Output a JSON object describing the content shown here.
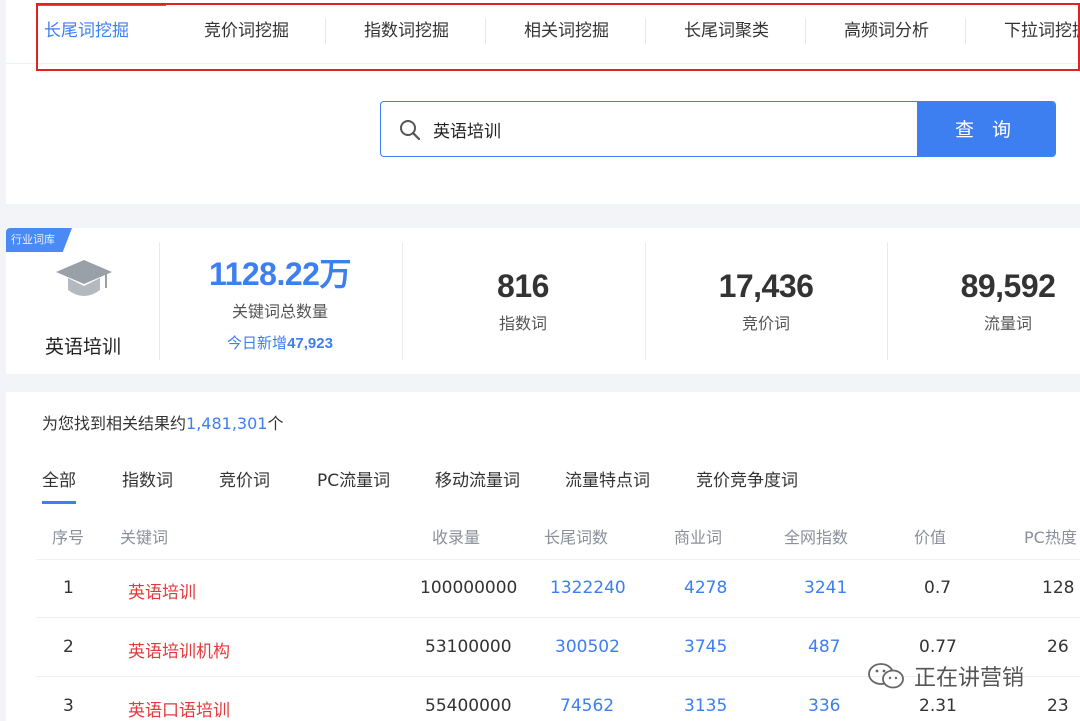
{
  "tabs": [
    {
      "label": "长尾词挖掘",
      "active": true
    },
    {
      "label": "竞价词挖掘"
    },
    {
      "label": "指数词挖掘"
    },
    {
      "label": "相关词挖掘"
    },
    {
      "label": "长尾词聚类"
    },
    {
      "label": "高频词分析"
    },
    {
      "label": "下拉词挖掘"
    }
  ],
  "search": {
    "value": "英语培训",
    "button_label": "查 询"
  },
  "industry": {
    "badge": "行业词库",
    "name": "英语培训"
  },
  "stats": {
    "total": {
      "value": "1128.22万",
      "label": "关键词总数量",
      "today_prefix": "今日新增",
      "today_value": "47,923"
    },
    "index_words": {
      "value": "816",
      "label": "指数词"
    },
    "bid_words": {
      "value": "17,436",
      "label": "竞价词"
    },
    "traffic_words": {
      "value": "89,592",
      "label": "流量词"
    }
  },
  "results": {
    "prefix": "为您找到相关结果约",
    "count": "1,481,301",
    "suffix": "个"
  },
  "filter_tabs": [
    "全部",
    "指数词",
    "竞价词",
    "PC流量词",
    "移动流量词",
    "流量特点词",
    "竞价竞争度词"
  ],
  "table": {
    "columns": [
      "序号",
      "关键词",
      "收录量",
      "长尾词数",
      "商业词",
      "全网指数",
      "价值",
      "PC热度"
    ],
    "rows": [
      [
        "1",
        "英语培训",
        "100000000",
        "1322240",
        "4278",
        "3241",
        "0.7",
        "128"
      ],
      [
        "2",
        "英语培训机构",
        "53100000",
        "300502",
        "3745",
        "487",
        "0.77",
        "26"
      ],
      [
        "3",
        "英语口语培训",
        "55400000",
        "74562",
        "3135",
        "336",
        "2.31",
        "23"
      ]
    ]
  },
  "watermark": {
    "text": "正在讲营销",
    "icon": "wechat-icon"
  },
  "colors": {
    "accent": "#3d7ef0",
    "keyword": "#e4393c",
    "highlight": "#e02222"
  }
}
